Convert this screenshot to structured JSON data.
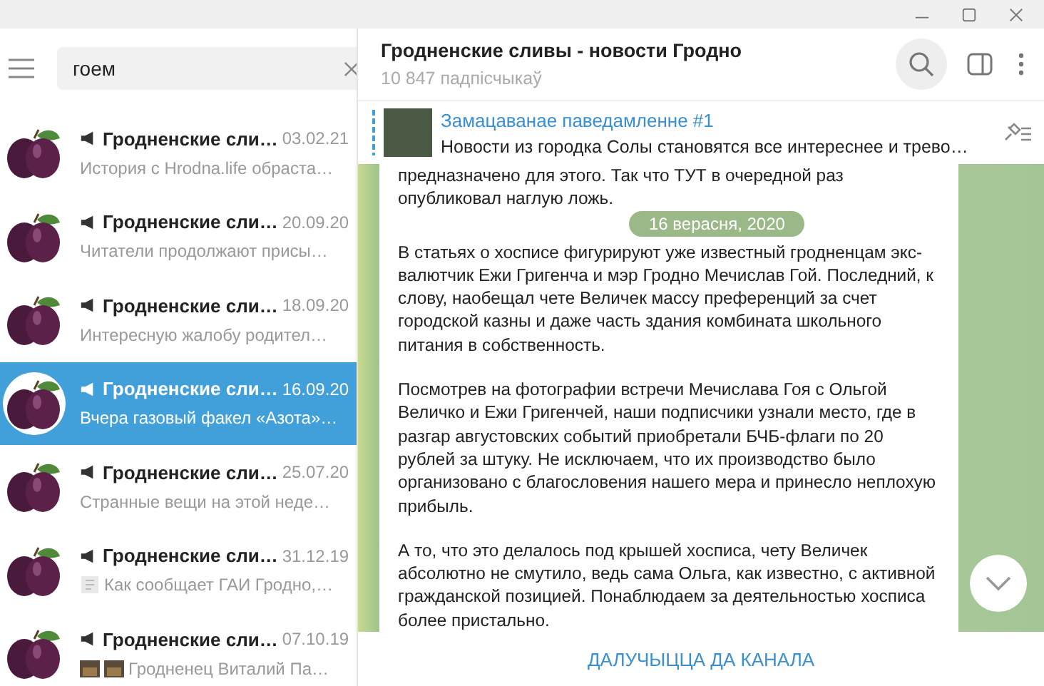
{
  "search": {
    "value": "гоем"
  },
  "chats": [
    {
      "name": "Гродненские сли…",
      "date": "03.02.21",
      "preview": "История с Hrodna.life обраста…",
      "selected": false
    },
    {
      "name": "Гродненские сли…",
      "date": "20.09.20",
      "preview": "Читатели продолжают присы…",
      "selected": false
    },
    {
      "name": "Гродненские сли…",
      "date": "18.09.20",
      "preview": "Интересную жалобу родител…",
      "selected": false
    },
    {
      "name": "Гродненские сли…",
      "date": "16.09.20",
      "preview": "Вчера газовый факел «Азота»…",
      "selected": true
    },
    {
      "name": "Гродненские сли…",
      "date": "25.07.20",
      "preview": "Странные вещи на этой неде…",
      "selected": false
    },
    {
      "name": "Гродненские сли…",
      "date": "31.12.19",
      "preview": "Как сообщает ГАИ Гродно,…",
      "attachments": [
        {
          "kind": "document"
        }
      ],
      "selected": false
    },
    {
      "name": "Гродненские сли…",
      "date": "07.10.19",
      "preview": "Гродненец Виталий Па…",
      "attachments": [
        {
          "kind": "photo"
        },
        {
          "kind": "photo"
        }
      ],
      "selected": false
    }
  ],
  "channel": {
    "title": "Гродненские сливы - новости Гродно",
    "subtitle": "10 847 падпісчыкаў"
  },
  "pinned": {
    "title": "Замацаванае паведамленне #1",
    "text": "Новости из городка Солы становятся все интереснее и трево…"
  },
  "date_badge": "16 верасня, 2020",
  "message": {
    "paragraphs": [
      "предназначено для этого. Так что ТУТ в очередной раз опубликовал наглую ложь.",
      "В статьях о хосписе фигурируют уже известный гродненцам экс-валютчик Ежи Григенча и мэр Гродно Мечислав Гой. Последний, к слову, наобещал чете Величек массу преференций за счет городской казны и даже часть здания комбината школьного питания в собственность.",
      "Посмотрев на фотографии встречи Мечислава Гоя с Ольгой Величко и Ежи Григенчей, наши подписчики узнали место, где в разгар августовских событий приобретали БЧБ-флаги по 20 рублей за штуку. Не исключаем, что их производство было организовано с благословения нашего мера и принесло неплохую прибыль.",
      "А то, что это делалось под крышей хосписа, чету Величек абсолютно не смутило, ведь сама Ольга, как известно, с активной гражданской позицией. Понаблюдаем за деятельностью хосписа более пристально."
    ]
  },
  "join_button": "ДАЛУЧЫЦЦА ДА КАНАЛА"
}
